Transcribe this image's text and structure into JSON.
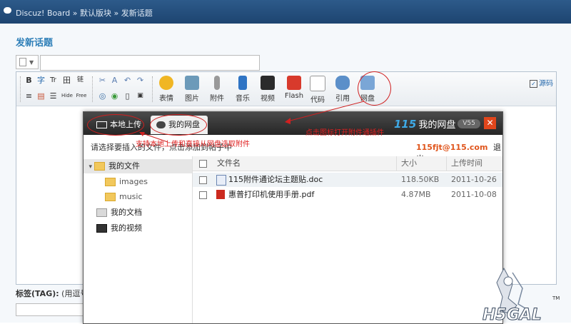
{
  "breadcrumb": {
    "site": "Discuz! Board",
    "sep1": "»",
    "forum": "默认版块",
    "sep2": "»",
    "page": "发新话题"
  },
  "page_title": "发新话题",
  "subject_value": "",
  "toolbar": {
    "small_icons_row1": [
      "B",
      "字",
      "Tr",
      "田",
      "链"
    ],
    "small_icons_row2": [
      "≡",
      "▤",
      "☰",
      "Hide",
      "Free"
    ],
    "buttons": [
      {
        "label": "表情",
        "color": "#f0b624"
      },
      {
        "label": "图片",
        "color": "#6c9ab9"
      },
      {
        "label": "附件",
        "color": "#999999"
      },
      {
        "label": "音乐",
        "color": "#2f74c4"
      },
      {
        "label": "视频",
        "color": "#2b2b2b"
      },
      {
        "label": "Flash",
        "color": "#d83a2c"
      },
      {
        "label": "代码",
        "color": "#888888"
      },
      {
        "label": "引用",
        "color": "#5b8fc9"
      },
      {
        "label": "网盘",
        "color": "#7aa6d6"
      }
    ],
    "source_label": "源码",
    "source_checked": "✓"
  },
  "tag_label": {
    "bold": "标签(TAG):",
    "rest": " (用逗号"
  },
  "dialog": {
    "tab_local": "本地上传",
    "tab_netdisk": "我的网盘",
    "brand_number": "115",
    "brand_name": "我的网盘",
    "version": "V55",
    "close": "✕",
    "hint": "请选择要插入的文件，点击添加到帖子中",
    "email": "115fjt@115.com",
    "logout": "退出",
    "tree": [
      {
        "label": "我的文件",
        "level": 0,
        "selected": true,
        "arrow": "▾"
      },
      {
        "label": "images",
        "level": 1
      },
      {
        "label": "music",
        "level": 1
      },
      {
        "label": "我的文档",
        "level": 0
      },
      {
        "label": "我的视频",
        "level": 0
      }
    ],
    "columns": {
      "name": "文件名",
      "size": "大小",
      "time": "上传时间"
    },
    "files": [
      {
        "name": "115附件通论坛主题贴.doc",
        "size": "118.50KB",
        "time": "2011-10-26",
        "type": "doc"
      },
      {
        "name": "惠普打印机使用手册.pdf",
        "size": "4.87MB",
        "time": "2011-10-08",
        "type": "pdf"
      }
    ]
  },
  "annotations": {
    "right": "点击图标打开附件通插件",
    "middle": "支持本地上传和直接从网盘选取附件"
  },
  "watermark": {
    "text": "H5GAL",
    "tm": "TM"
  },
  "colors": {
    "accent": "#2e7fb8",
    "brand": "#3ea9e5",
    "annotation": "#e02020",
    "email": "#e0551c"
  }
}
